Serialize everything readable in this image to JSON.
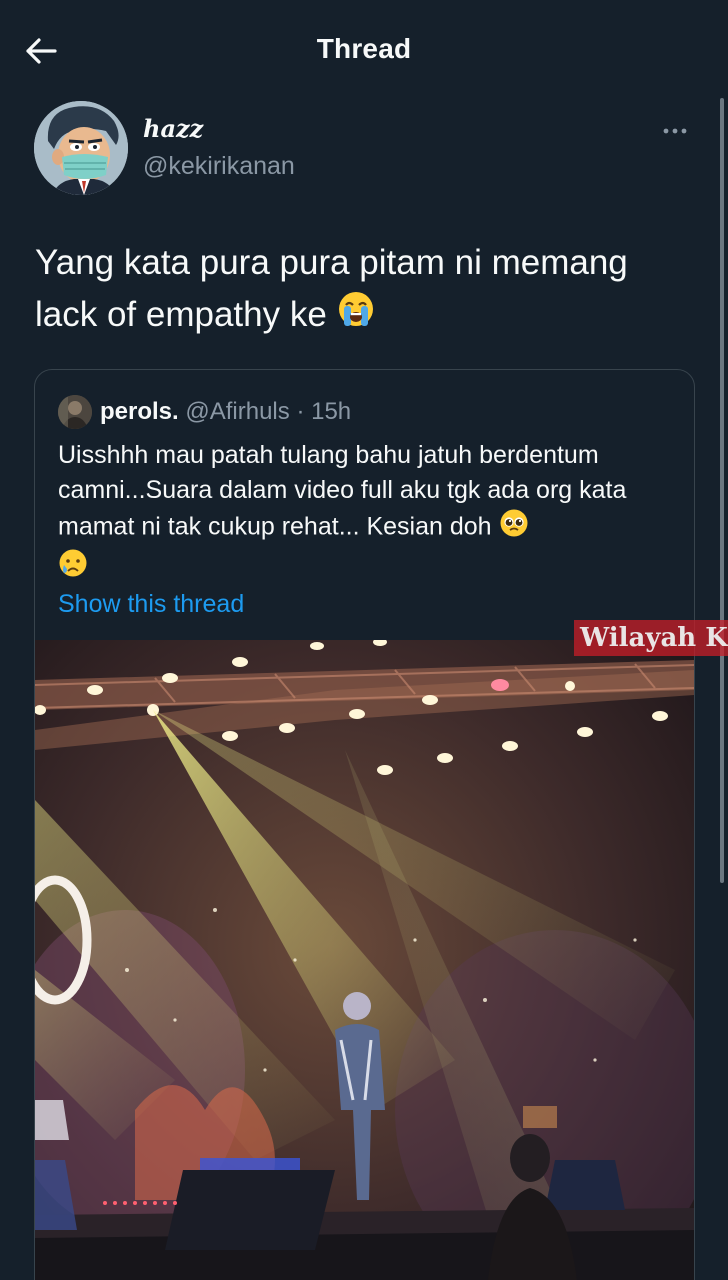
{
  "header": {
    "title": "Thread",
    "back_icon": "arrow-left-icon"
  },
  "tweet": {
    "display_name": "ᴴɑᶻᶻ",
    "display_name_text": "hazz",
    "handle": "@kekirikanan",
    "text": "Yang kata pura pura pitam ni memang lack of empathy ke",
    "emoji": "loudly-crying-face"
  },
  "quote": {
    "name": "perols.",
    "handle": "@Afirhuls",
    "separator": "·",
    "time": "15h",
    "text": "Uisshhh mau patah tulang bahu jatuh berdentum camni...Suara dalam video full aku tgk  ada org kata mamat ni tak cukup rehat... Kesian doh",
    "emojis": [
      "pleading-face",
      "crying-face"
    ],
    "show_thread": "Show this thread"
  },
  "media": {
    "watermark": "Wilayah K",
    "description_icon": "concert-stage-video"
  },
  "colors": {
    "background": "#15202b",
    "text": "#f7f9f9",
    "secondary": "#8b98a5",
    "link": "#1d9bf0",
    "border": "#38444d"
  }
}
